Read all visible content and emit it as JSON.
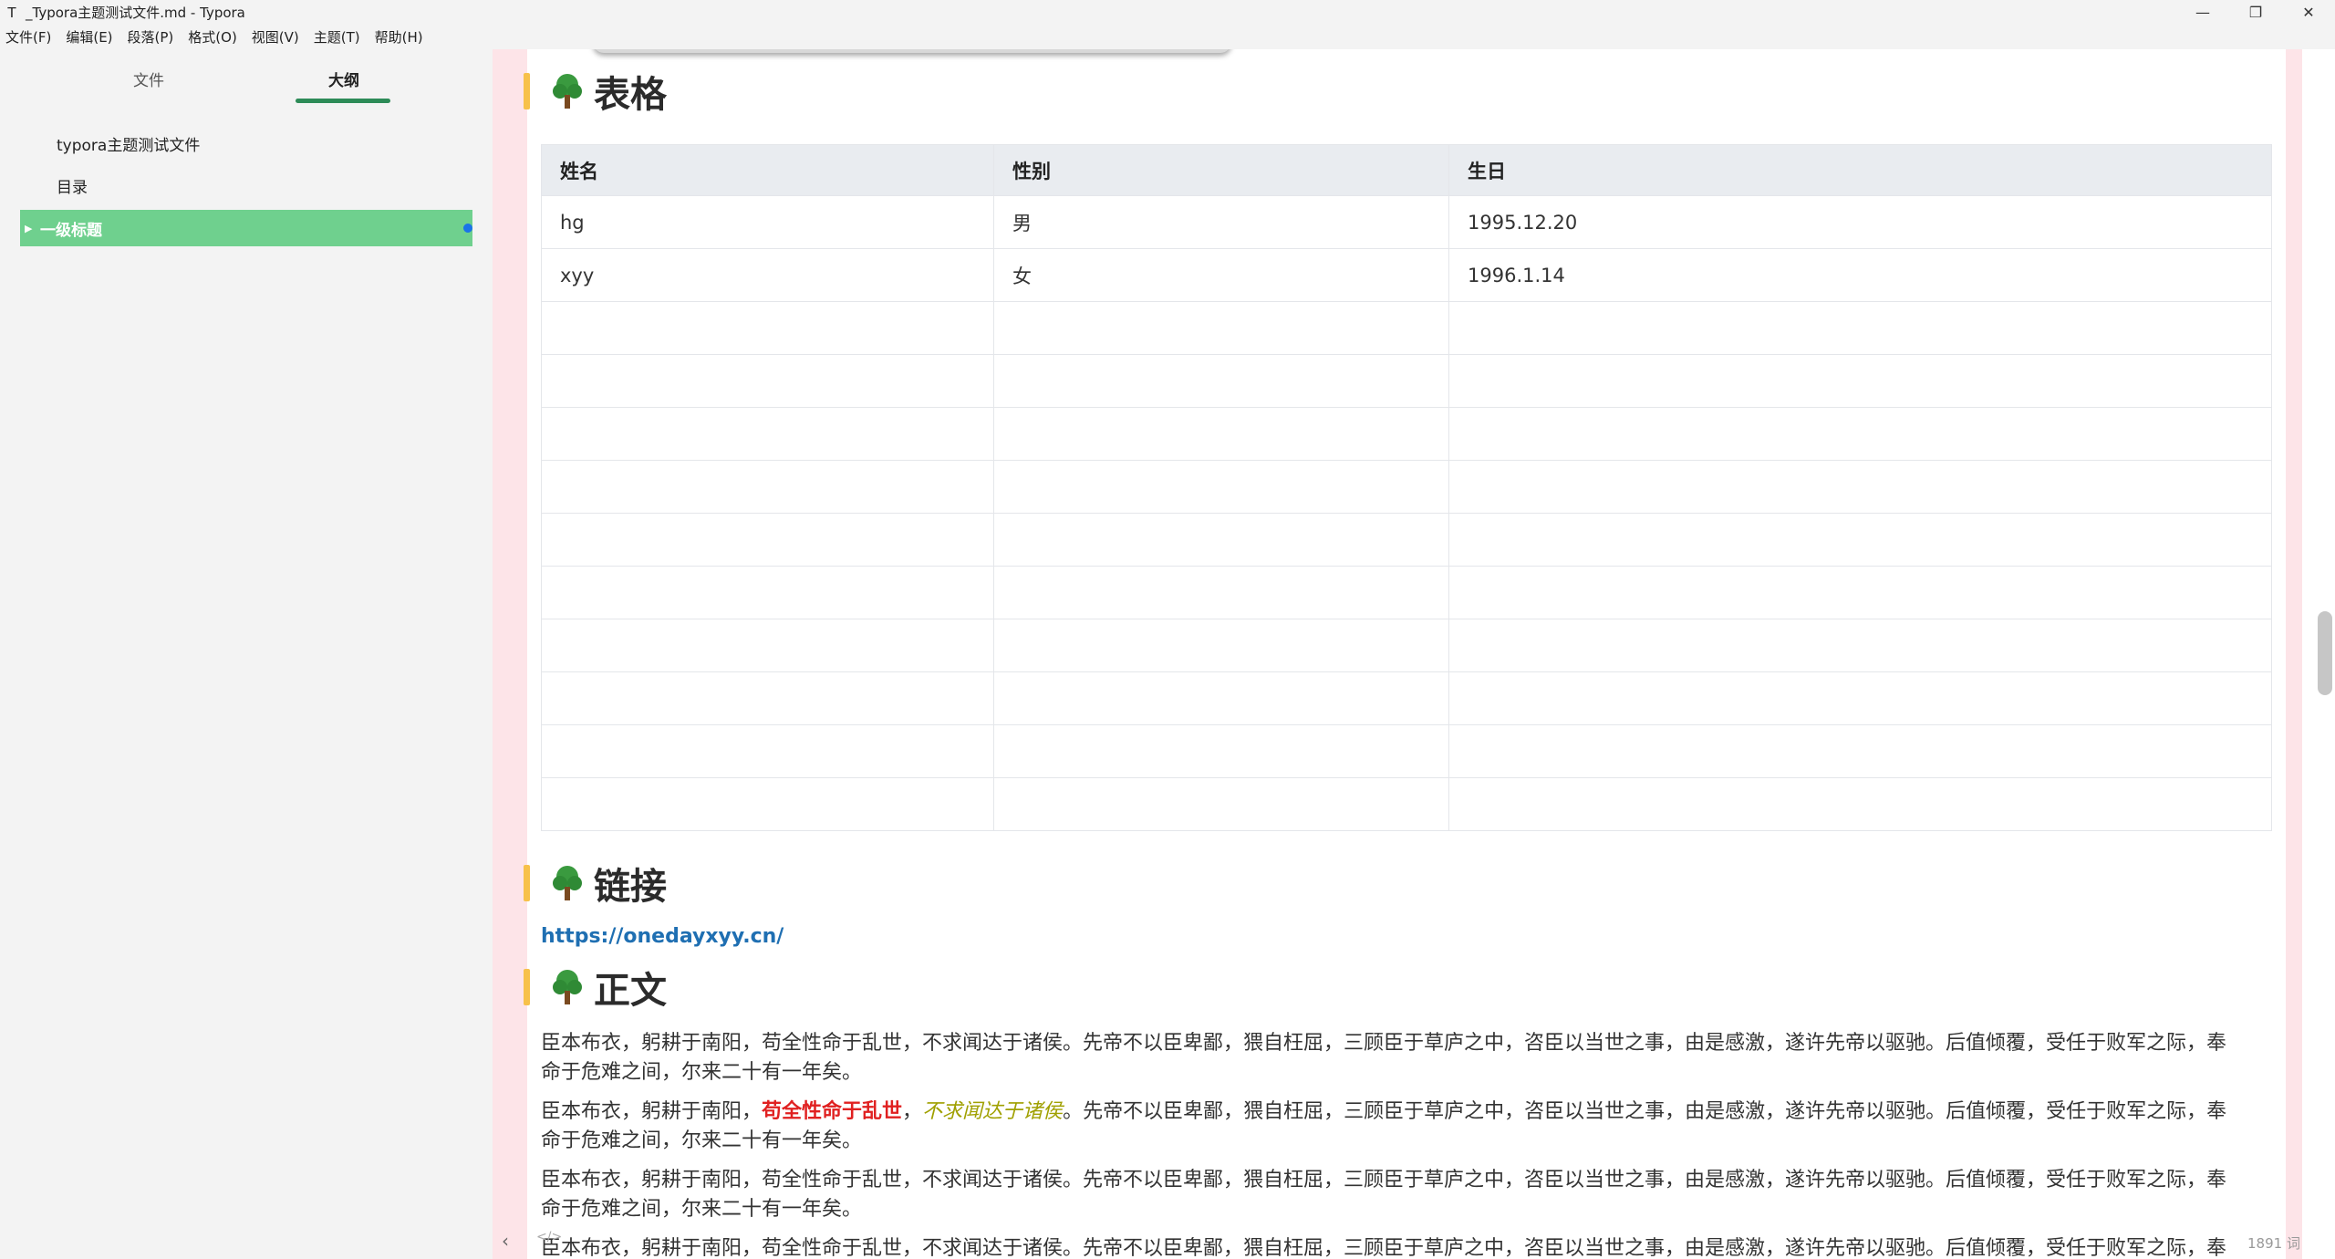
{
  "window": {
    "title": "_Typora主题测试文件.md - Typora",
    "app_icon": "T",
    "controls": {
      "minimize": "—",
      "maximize": "❐",
      "close": "✕"
    }
  },
  "menu": [
    "文件(F)",
    "编辑(E)",
    "段落(P)",
    "格式(O)",
    "视图(V)",
    "主题(T)",
    "帮助(H)"
  ],
  "sidebar": {
    "tabs": {
      "files": "文件",
      "outline": "大纲"
    },
    "outline_items": [
      "typora主题测试文件",
      "目录",
      "一级标题"
    ]
  },
  "headings": {
    "table": "表格",
    "links": "链接",
    "body": "正文"
  },
  "table": {
    "headers": [
      "姓名",
      "性别",
      "生日"
    ],
    "rows": [
      [
        "hg",
        "男",
        "1995.12.20"
      ],
      [
        "xyy",
        "女",
        "1996.1.14"
      ]
    ]
  },
  "link": {
    "url": "https://onedayxyy.cn/"
  },
  "paragraphs": {
    "p1_line1": "臣本布衣，躬耕于南阳，苟全性命于乱世，不求闻达于诸侯。先帝不以臣卑鄙，猥自枉屈，三顾臣于草庐之中，咨臣以当世之事，由是感激，遂许先帝以驱驰。后值倾覆，受任于败军之际，奉",
    "p1_line2": "命于危难之间，尔来二十有一年矣。",
    "p2_prefix": "臣本布衣，躬耕于南阳，",
    "p2_bold": "苟全性命于乱世",
    "p2_comma": "，",
    "p2_italic": "不求闻达于诸侯",
    "p2_rest": "。先帝不以臣卑鄙，猥自枉屈，三顾臣于草庐之中，咨臣以当世之事，由是感激，遂许先帝以驱驰。后值倾覆，受任于败军之际，奉",
    "p2_line2": "命于危难之间，尔来二十有一年矣。",
    "p3_line1": "臣本布衣，躬耕于南阳，苟全性命于乱世，不求闻达于诸侯。先帝不以臣卑鄙，猥自枉屈，三顾臣于草庐之中，咨臣以当世之事，由是感激，遂许先帝以驱驰。后值倾覆，受任于败军之际，奉",
    "p3_line2": "命于危难之间，尔来二十有一年矣。",
    "p4_line1": "臣本布衣，躬耕于南阳，苟全性命于乱世，不求闻达于诸侯。先帝不以臣卑鄙，猥自枉屈，三顾臣于草庐之中，咨臣以当世之事，由是感激，遂许先帝以驱驰。后值倾覆，受任于败军之际，奉"
  },
  "status": {
    "toggle_sidebar": "‹",
    "source_mode": "</>",
    "word_count": "1891 词"
  },
  "colors": {
    "accent_green": "#2d8b57",
    "outline_active": "#6fd08e",
    "heading_bar": "#f7c14a",
    "margin_pink": "#fde4e8",
    "link": "#1f6fb2",
    "bold_red": "#e02020",
    "italic_olive": "#a0a000"
  },
  "icons": {
    "heading_icon": "tree-icon"
  }
}
